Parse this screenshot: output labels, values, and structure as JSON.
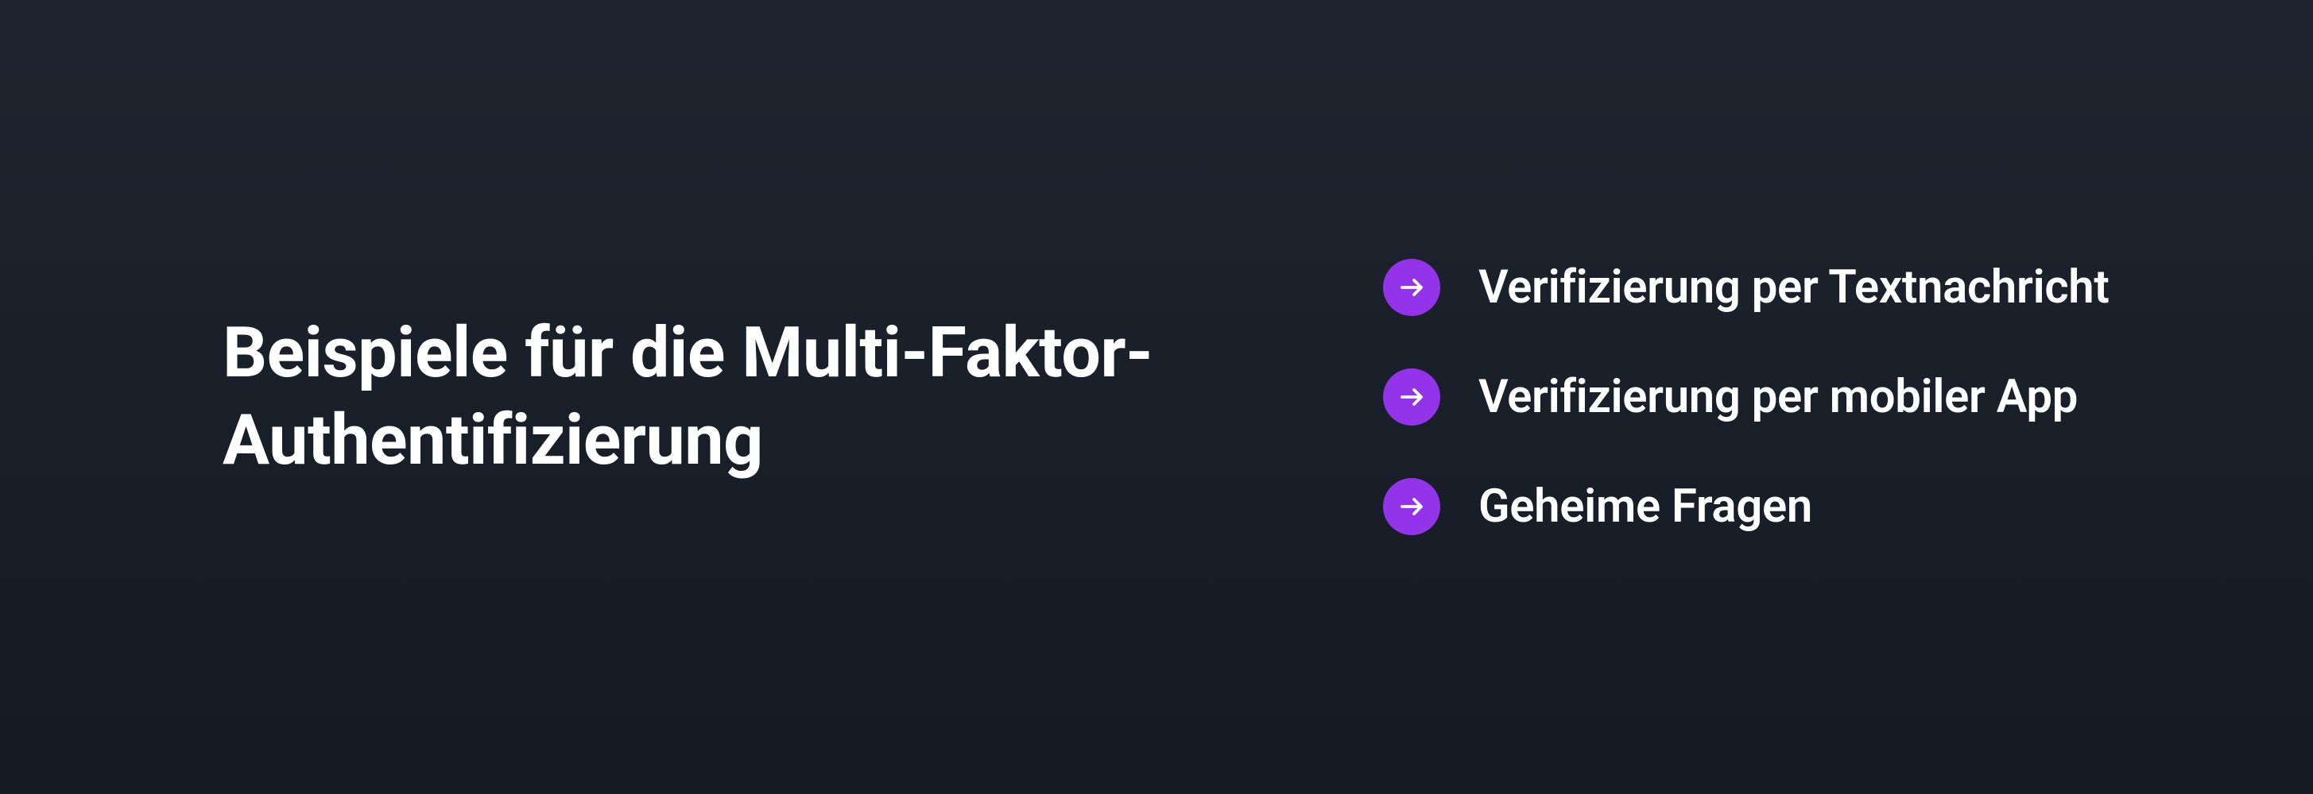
{
  "heading": "Beispiele für die Multi-Faktor-Authentifizierung",
  "items": [
    {
      "label": "Verifizierung per Textnachricht"
    },
    {
      "label": "Verifizierung per mobiler App"
    },
    {
      "label": "Geheime Fragen"
    }
  ],
  "colors": {
    "bullet": "#9333ea",
    "text": "#ffffff"
  }
}
